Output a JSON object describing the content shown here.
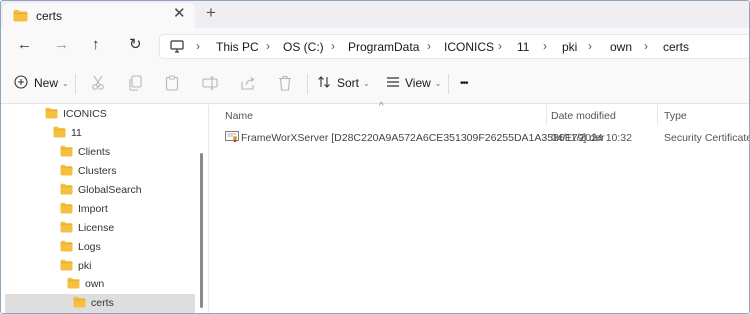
{
  "tab": {
    "title": "certs",
    "close_glyph": "✕",
    "new_tab_glyph": "+"
  },
  "nav": {
    "back_icon": "arrow-left-icon",
    "forward_icon": "arrow-right-icon",
    "up_icon": "arrow-up-icon",
    "refresh_icon": "refresh-icon",
    "back_glyph": "←",
    "forward_glyph": "→",
    "up_glyph": "↑",
    "refresh_glyph": "↻"
  },
  "breadcrumb": {
    "separator": "›",
    "items": [
      "This PC",
      "OS (C:)",
      "ProgramData",
      "ICONICS",
      "11",
      "pki",
      "own",
      "certs"
    ]
  },
  "commands": {
    "new_label": "New",
    "sort_label": "Sort",
    "view_label": "View",
    "more_label": "•••",
    "caret": "⌄"
  },
  "tree": [
    {
      "label": "ICONICS"
    },
    {
      "label": "11"
    },
    {
      "label": "Clients"
    },
    {
      "label": "Clusters"
    },
    {
      "label": "GlobalSearch"
    },
    {
      "label": "Import"
    },
    {
      "label": "License"
    },
    {
      "label": "Logs"
    },
    {
      "label": "pki"
    },
    {
      "label": "own"
    },
    {
      "label": "certs",
      "selected": true
    }
  ],
  "columns": {
    "name": "Name",
    "date": "Date modified",
    "type": "Type",
    "sort_glyph": "^"
  },
  "files": [
    {
      "name": "FrameWorXServer [D28C220A9A572A6CE351309F26255DA1A3586E79].der",
      "date": "04/11/2024 10:32",
      "type": "Security Certificate"
    }
  ],
  "colors": {
    "folder": "#f5c040",
    "folder_dark": "#e0a820",
    "accent": "#0067c0",
    "selection": "#dedede"
  }
}
